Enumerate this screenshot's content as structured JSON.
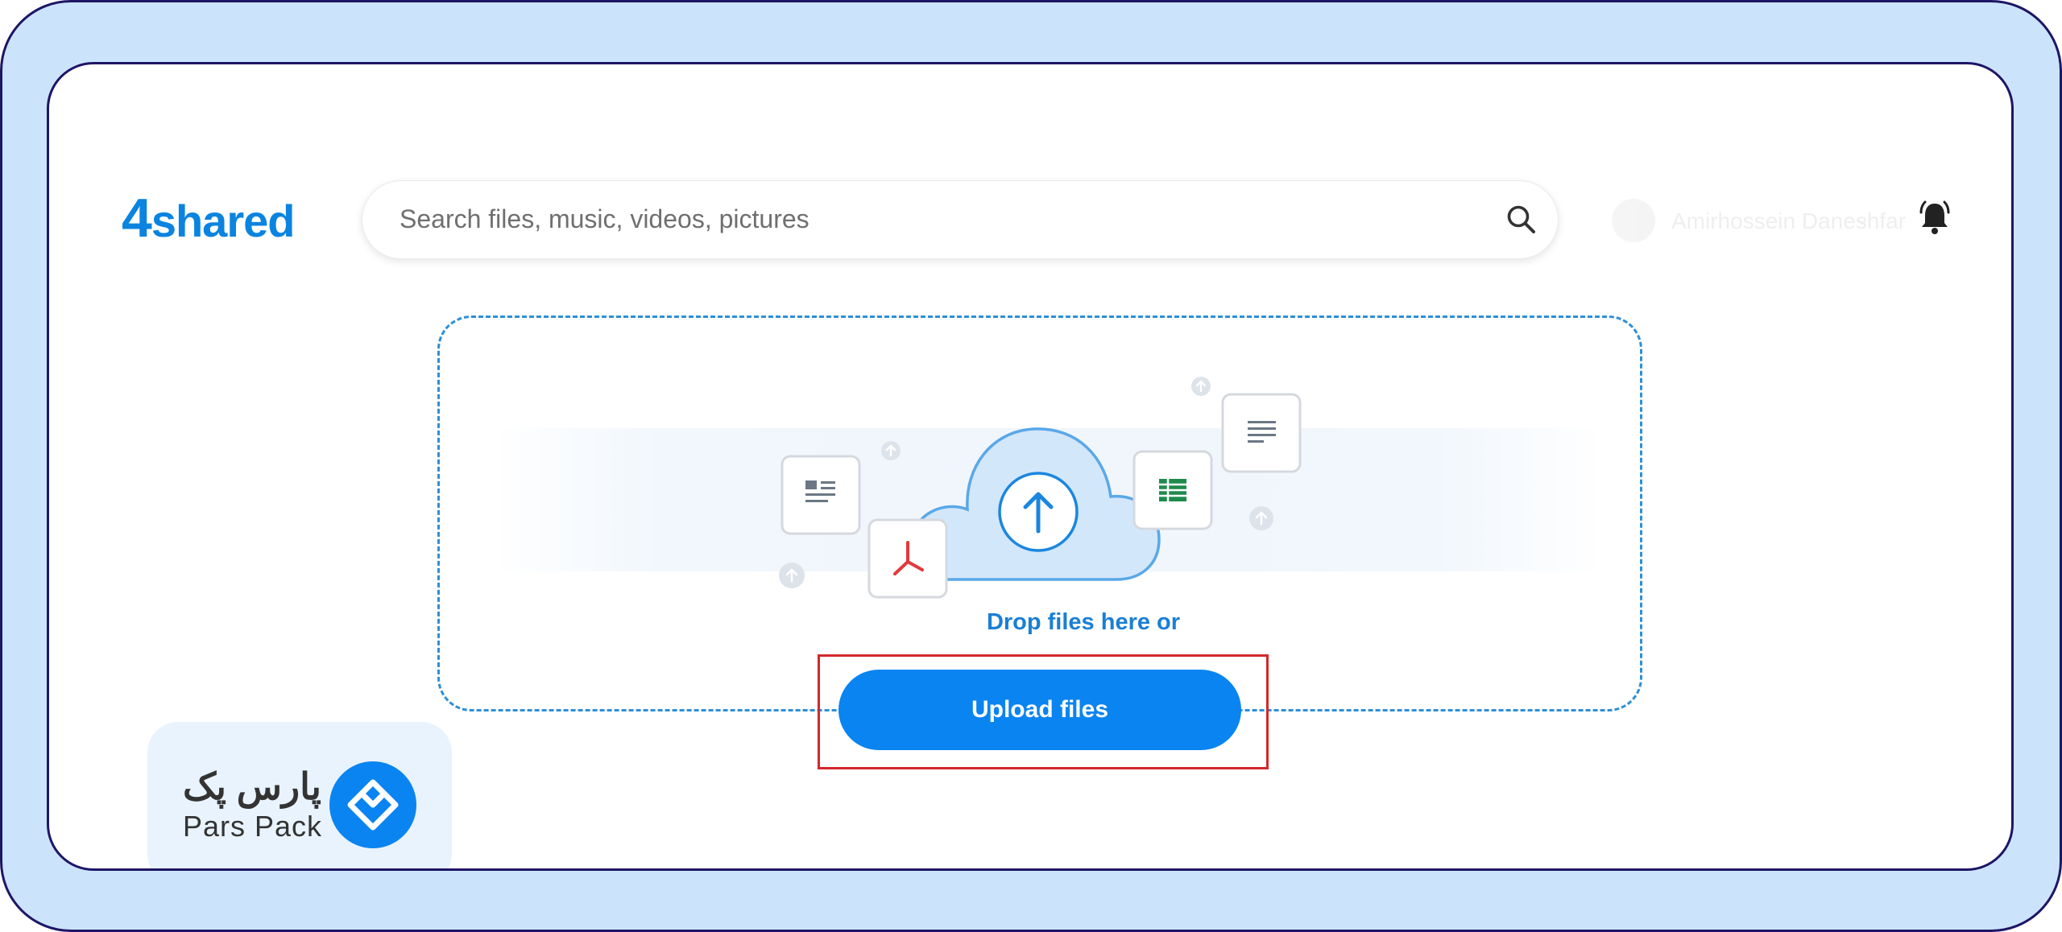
{
  "header": {
    "logo_number": "4",
    "logo_word": "shared",
    "search_placeholder": "Search files, music, videos, pictures",
    "user_name": "Amirhossein Daneshfar"
  },
  "upload": {
    "drop_text": "Drop files here or",
    "button_label": "Upload files"
  },
  "watermark": {
    "name_fa": "پارس پک",
    "name_en": "Pars Pack"
  },
  "colors": {
    "brand_blue": "#0a84f0",
    "frame_fill": "#cce4fb",
    "frame_border": "#1e1666",
    "highlight_red": "#d3272c",
    "dashed_border": "#2e8fd8"
  },
  "icons": {
    "search": "search-icon",
    "notifications": "bell-alert-icon",
    "upload": "cloud-upload-icon",
    "documents": [
      "text-doc-icon",
      "pdf-doc-icon",
      "spreadsheet-doc-icon",
      "article-doc-icon"
    ]
  }
}
